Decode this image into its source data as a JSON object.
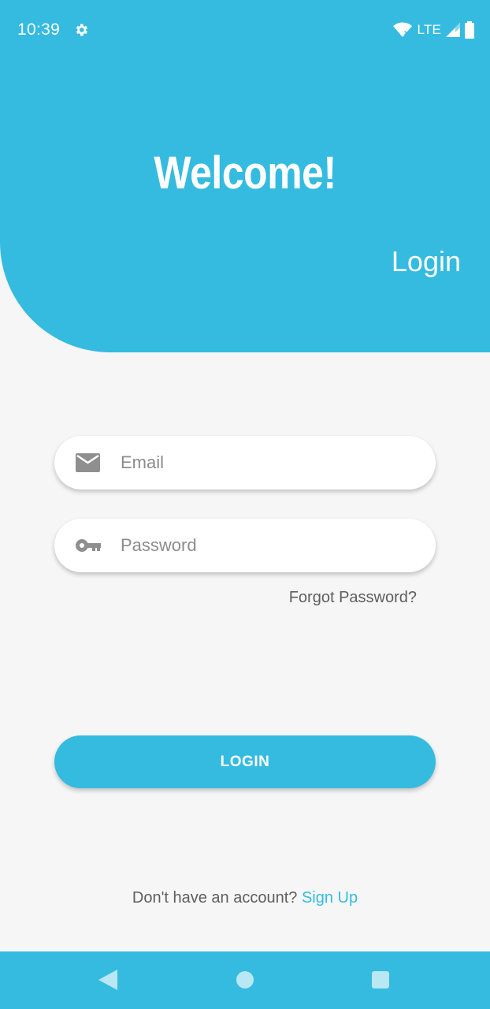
{
  "status_bar": {
    "time": "10:39",
    "network": "LTE",
    "icons": [
      "settings-gear-icon",
      "wifi-icon",
      "signal-icon",
      "battery-icon"
    ]
  },
  "header": {
    "welcome": "Welcome!",
    "title": "Login"
  },
  "form": {
    "email": {
      "placeholder": "Email",
      "value": "",
      "icon": "email-icon"
    },
    "password": {
      "placeholder": "Password",
      "value": "",
      "icon": "key-icon"
    },
    "forgot_label": "Forgot Password?",
    "login_label": "LOGIN"
  },
  "footer": {
    "prompt": "Don't have an account?",
    "signup_label": "Sign Up"
  },
  "nav": [
    "back-icon",
    "home-icon",
    "recents-icon"
  ],
  "colors": {
    "accent": "#35bbe0",
    "background": "#f6f6f6",
    "text_muted": "#5e5e5e",
    "icon_grey": "#8f8f8f"
  }
}
